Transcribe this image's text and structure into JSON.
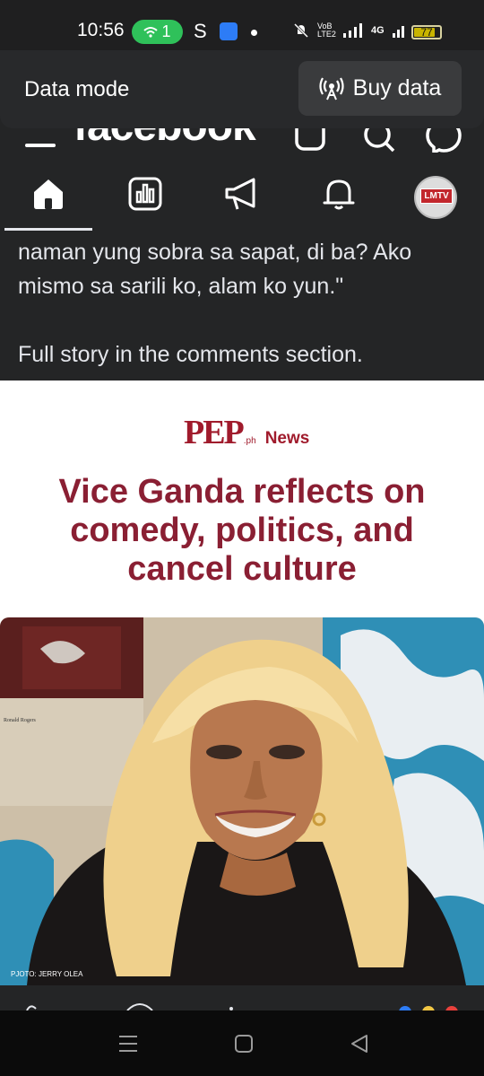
{
  "status_bar": {
    "time": "10:56",
    "hotspot_count": "1",
    "s_label": "S",
    "network_label": "4G",
    "volte_label": "VoLTE",
    "battery_level": "77"
  },
  "data_mode": {
    "label": "Data mode",
    "buy_label": "Buy data"
  },
  "facebook": {
    "logo_text": "facebook",
    "nav_tabs": [
      "home",
      "dashboard",
      "announcements",
      "notifications",
      "profile"
    ],
    "avatar_text": "LMTV"
  },
  "post": {
    "text": "naman yung sobra sa sapat, di ba? Ako mismo sa sarili ko, alam ko yun.\"",
    "cta": "Full story in the comments section."
  },
  "article": {
    "brand": "PEP",
    "brand_suffix": ".ph",
    "brand_section": "News",
    "headline": "Vice Ganda reflects on comedy, politics, and cancel culture",
    "photo_credit": "PJOTO: JERRY OLEA",
    "frame_caption": "Ronald Rogers"
  },
  "colors": {
    "accent": "#8a1f33",
    "brand": "#a01b2c",
    "background": "#242526",
    "hotspot": "#2fc15a"
  }
}
